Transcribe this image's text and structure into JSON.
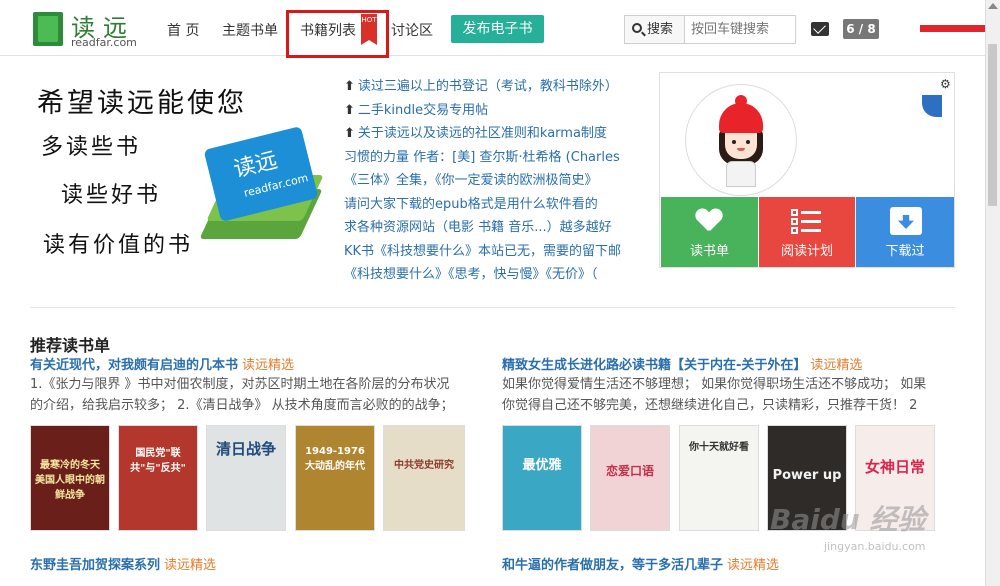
{
  "nav": {
    "logo_cn": "读远",
    "logo_en": "readfar.com",
    "items": [
      "首 页",
      "主题书单",
      "书籍列表",
      "讨论区"
    ],
    "hot": "HOT",
    "publish": "发布电子书",
    "search_label": "搜索",
    "search_placeholder": "按回车键搜索",
    "msg_count": "6 / 8"
  },
  "banner": {
    "slogans": [
      "希望读远能使您",
      "多读些书",
      "读些好书",
      "读有价值的书"
    ],
    "book_cn": "读远",
    "book_en": "readfar.com"
  },
  "notices": [
    "读过三遍以上的书登记（考试，教科书除外）",
    "二手kindle交易专用帖",
    "关于读远以及读远的社区准则和karma制度",
    "习惯的力量 作者：[美] 查尔斯·杜希格 (Charles",
    "《三体》全集，《你一定爱读的欧洲极简史》",
    "请问大家下载的epub格式是用什么软件看的",
    "求各种资源网站（电影 书籍 音乐...）越多越好",
    "KK书《科技想要什么》本站已无，需要的留下邮",
    "《科技想要什么》《思考，快与慢》《无价》（"
  ],
  "profile": {
    "gear": "⚙",
    "tiles": [
      "读书单",
      "阅读计划",
      "下载过"
    ]
  },
  "recommend": {
    "heading": "推荐读书单",
    "pick_label": "读远精选",
    "lists": [
      {
        "title": "有关近现代，对我颇有启迪的几本书",
        "desc1": "1.《张力与限界 》书中对佃农制度，对苏区时期土地在各阶层的分布状况",
        "desc2": "的介绍，给我启示较多； 2.《清日战争》 从技术角度而言必败的的战争；",
        "covers": [
          {
            "text": "最寒冷的冬天 美国人眼中的朝鲜战争",
            "bg": "#6b1f1a",
            "fg": "#f5e6a0"
          },
          {
            "text": "国民党\"联共\"与\"反共\"",
            "bg": "#b3372c",
            "fg": "#ffffff"
          },
          {
            "text": "清日战争",
            "bg": "#dfe3e4",
            "fg": "#1f4a7a"
          },
          {
            "text": "1949-1976 大动乱的年代",
            "bg": "#b08530",
            "fg": "#ffffff"
          },
          {
            "text": "中共党史研究",
            "bg": "#e6ddc9",
            "fg": "#8c3a2a"
          }
        ]
      },
      {
        "title": "精致女生成长进化路必读书籍【关于内在-关于外在】",
        "desc1": "如果你觉得爱情生活还不够理想； 如果你觉得职场生活还不够成功； 如果",
        "desc2": "你觉得自己还不够完美，还想继续进化自己，只读精彩，只推荐干货！ 2",
        "covers": [
          {
            "text": "最优雅",
            "bg": "#3aa7c4",
            "fg": "#ffffff"
          },
          {
            "text": "恋爱口语",
            "bg": "#f1d3d6",
            "fg": "#c0304a"
          },
          {
            "text": "你十天就好看",
            "bg": "#f4f4f0",
            "fg": "#333333"
          },
          {
            "text": "Power up",
            "bg": "#2f2b28",
            "fg": "#f2f2f2"
          },
          {
            "text": "女神日常",
            "bg": "#f6ecea",
            "fg": "#d8264e"
          }
        ]
      },
      {
        "title": "东野圭吾加贺探案系列"
      },
      {
        "title": "和牛逼的作者做朋友，等于多活几辈子"
      }
    ]
  },
  "watermark": {
    "main": "Baidu 经验",
    "sub": "jingyan.baidu.com"
  }
}
